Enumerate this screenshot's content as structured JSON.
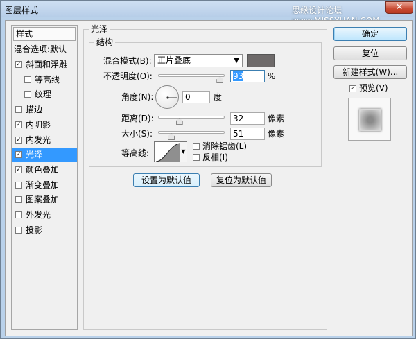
{
  "window": {
    "title": "图层样式",
    "watermark": "思缘设计论坛 www.MISSYUAN.COM",
    "close_glyph": "✕"
  },
  "sidebar": {
    "header": "样式",
    "blend_options": "混合选项:默认",
    "items": [
      {
        "label": "斜面和浮雕",
        "checked": "✓",
        "indent": false
      },
      {
        "label": "等高线",
        "checked": "",
        "indent": true
      },
      {
        "label": "纹理",
        "checked": "",
        "indent": true
      },
      {
        "label": "描边",
        "checked": "",
        "indent": false
      },
      {
        "label": "内阴影",
        "checked": "✓",
        "indent": false
      },
      {
        "label": "内发光",
        "checked": "✓",
        "indent": false
      },
      {
        "label": "光泽",
        "checked": "✓",
        "indent": false,
        "selected": true
      },
      {
        "label": "颜色叠加",
        "checked": "✓",
        "indent": false
      },
      {
        "label": "渐变叠加",
        "checked": "",
        "indent": false
      },
      {
        "label": "图案叠加",
        "checked": "",
        "indent": false
      },
      {
        "label": "外发光",
        "checked": "",
        "indent": false
      },
      {
        "label": "投影",
        "checked": "",
        "indent": false
      }
    ]
  },
  "satin": {
    "group_title": "光泽",
    "structure_title": "结构",
    "blend_mode_label": "混合模式(B):",
    "blend_mode_value": "正片叠底",
    "blend_color": "#6e6a6a",
    "opacity_label": "不透明度(O):",
    "opacity_value": "93",
    "opacity_unit": "%",
    "opacity_level": 0.93,
    "angle_label": "角度(N):",
    "angle_value": "0",
    "angle_unit": "度",
    "distance_label": "距离(D):",
    "distance_value": "32",
    "distance_unit": "像素",
    "distance_level": 0.32,
    "size_label": "大小(S):",
    "size_value": "51",
    "size_unit": "像素",
    "size_level": 0.2,
    "contour_label": "等高线:",
    "antialias_label": "消除锯齿(L)",
    "invert_label": "反相(I)",
    "set_default": "设置为默认值",
    "reset_default": "复位为默认值"
  },
  "actions": {
    "ok": "确定",
    "reset": "复位",
    "new_style": "新建样式(W)...",
    "preview_label": "预览(V)",
    "preview_checked": "✓"
  }
}
